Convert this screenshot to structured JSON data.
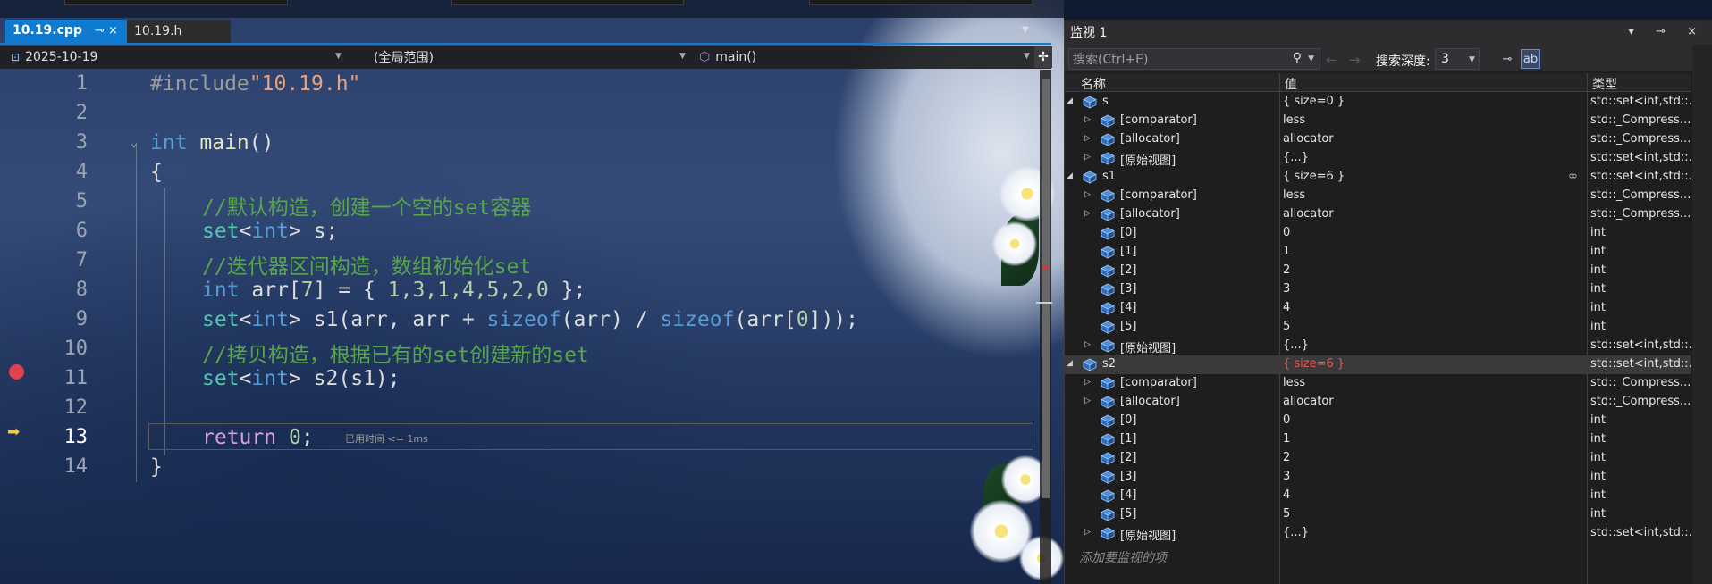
{
  "tabs": [
    {
      "label": "10.19.cpp",
      "icon": "⊸ ×",
      "active": true
    },
    {
      "label": "10.19.h",
      "active": false
    }
  ],
  "navbar": {
    "project": "2025-10-19",
    "scope": "(全局范围)",
    "member": "main()"
  },
  "code_lines": [
    {
      "num": "1"
    },
    {
      "num": "2"
    },
    {
      "num": "3"
    },
    {
      "num": "4"
    },
    {
      "num": "5"
    },
    {
      "num": "6"
    },
    {
      "num": "7"
    },
    {
      "num": "8"
    },
    {
      "num": "9"
    },
    {
      "num": "10"
    },
    {
      "num": "11"
    },
    {
      "num": "12"
    },
    {
      "num": "13"
    },
    {
      "num": "14"
    }
  ],
  "code": {
    "l1a": "#include",
    "l1b": "\"10.19.h\"",
    "l3a": "int",
    "l3b": " main",
    "l3c": "()",
    "l4": "{",
    "l5": "//默认构造，创建一个空的set容器",
    "l6a": "set",
    "l6b": "<",
    "l6c": "int",
    "l6d": "> s;",
    "l7": "//迭代器区间构造，数组初始化set",
    "l8a": "int",
    "l8b": " arr[",
    "l8c": "7",
    "l8d": "] = { ",
    "l8e": "1,3,1,4,5,2,0",
    "l8f": " };",
    "l9a": "set",
    "l9b": "<",
    "l9c": "int",
    "l9d": "> s1(arr, arr + ",
    "l9e": "sizeof",
    "l9f": "(arr) / ",
    "l9g": "sizeof",
    "l9h": "(arr[",
    "l9i": "0",
    "l9j": "]));",
    "l10": "//拷贝构造，根据已有的set创建新的set",
    "l11a": "set",
    "l11b": "<",
    "l11c": "int",
    "l11d": "> s2(s1);",
    "l13a": "return",
    "l13b": " ",
    "l13c": "0",
    "l13d": ";",
    "l14": "}"
  },
  "elapsed_hint": "已用时间 <= 1ms",
  "watch": {
    "title": "监视 1",
    "title_buttons": "▾ ⊸ ×",
    "search_placeholder": "搜索(Ctrl+E)",
    "search_depth_label": "搜索深度:",
    "search_depth_value": "3",
    "columns": {
      "name": "名称",
      "value": "值",
      "type": "类型"
    },
    "add_watch_text": "添加要监视的项",
    "rows": [
      {
        "depth": 0,
        "exp": "◢",
        "name": "s",
        "value": "{ size=0 }",
        "type": "std::set<int,std::..."
      },
      {
        "depth": 1,
        "exp": "▷",
        "name": "[comparator]",
        "value": "less",
        "type": "std::_Compress..."
      },
      {
        "depth": 1,
        "exp": "▷",
        "name": "[allocator]",
        "value": "allocator",
        "type": "std::_Compress..."
      },
      {
        "depth": 1,
        "exp": "▷",
        "name": "[原始视图]",
        "value": "{...}",
        "type": "std::set<int,std::..."
      },
      {
        "depth": 0,
        "exp": "◢",
        "name": "s1",
        "value": "{ size=6 }",
        "type": "std::set<int,std::...",
        "lens": "∞"
      },
      {
        "depth": 1,
        "exp": "▷",
        "name": "[comparator]",
        "value": "less",
        "type": "std::_Compress..."
      },
      {
        "depth": 1,
        "exp": "▷",
        "name": "[allocator]",
        "value": "allocator",
        "type": "std::_Compress..."
      },
      {
        "depth": 1,
        "exp": "",
        "name": "[0]",
        "value": "0",
        "type": "int"
      },
      {
        "depth": 1,
        "exp": "",
        "name": "[1]",
        "value": "1",
        "type": "int"
      },
      {
        "depth": 1,
        "exp": "",
        "name": "[2]",
        "value": "2",
        "type": "int"
      },
      {
        "depth": 1,
        "exp": "",
        "name": "[3]",
        "value": "3",
        "type": "int"
      },
      {
        "depth": 1,
        "exp": "",
        "name": "[4]",
        "value": "4",
        "type": "int"
      },
      {
        "depth": 1,
        "exp": "",
        "name": "[5]",
        "value": "5",
        "type": "int"
      },
      {
        "depth": 1,
        "exp": "▷",
        "name": "[原始视图]",
        "value": "{...}",
        "type": "std::set<int,std::..."
      },
      {
        "depth": 0,
        "exp": "◢",
        "name": "s2",
        "value": "{ size=6 }",
        "type": "std::set<int,std::...",
        "changed": true,
        "selected": true
      },
      {
        "depth": 1,
        "exp": "▷",
        "name": "[comparator]",
        "value": "less",
        "type": "std::_Compress..."
      },
      {
        "depth": 1,
        "exp": "▷",
        "name": "[allocator]",
        "value": "allocator",
        "type": "std::_Compress..."
      },
      {
        "depth": 1,
        "exp": "",
        "name": "[0]",
        "value": "0",
        "type": "int"
      },
      {
        "depth": 1,
        "exp": "",
        "name": "[1]",
        "value": "1",
        "type": "int"
      },
      {
        "depth": 1,
        "exp": "",
        "name": "[2]",
        "value": "2",
        "type": "int"
      },
      {
        "depth": 1,
        "exp": "",
        "name": "[3]",
        "value": "3",
        "type": "int"
      },
      {
        "depth": 1,
        "exp": "",
        "name": "[4]",
        "value": "4",
        "type": "int"
      },
      {
        "depth": 1,
        "exp": "",
        "name": "[5]",
        "value": "5",
        "type": "int"
      },
      {
        "depth": 1,
        "exp": "▷",
        "name": "[原始视图]",
        "value": "{...}",
        "type": "std::set<int,std::..."
      }
    ]
  },
  "colors": {
    "accent": "#0e7bd0",
    "changed_value": "#f25454",
    "breakpoint": "#e0414e"
  }
}
